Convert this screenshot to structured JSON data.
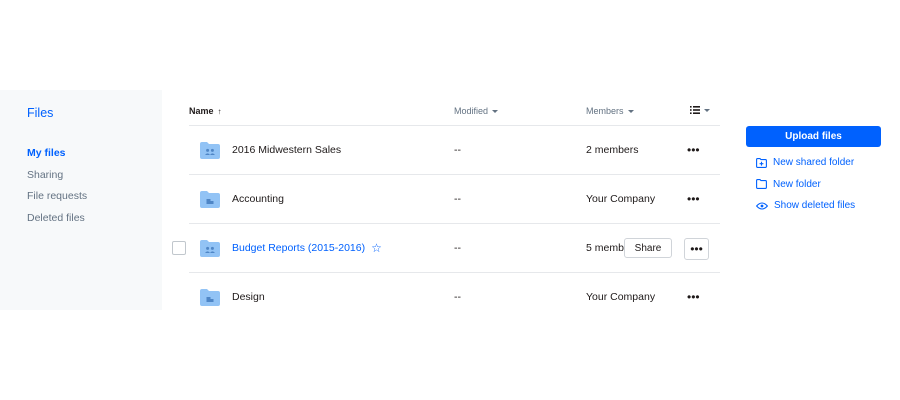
{
  "sidebar": {
    "brand": "Files",
    "items": [
      {
        "label": "My files",
        "active": true
      },
      {
        "label": "Sharing"
      },
      {
        "label": "File requests"
      },
      {
        "label": "Deleted files"
      }
    ]
  },
  "table": {
    "headers": {
      "name": "Name",
      "modified": "Modified",
      "members": "Members"
    },
    "rows": [
      {
        "name": "2016 Midwestern Sales",
        "modified": "--",
        "members": "2 members",
        "icon": "shared-folder-icon"
      },
      {
        "name": "Accounting",
        "modified": "--",
        "members": "Your Company",
        "icon": "team-folder-icon"
      },
      {
        "name": "Budget Reports (2015-2016)",
        "modified": "--",
        "members": "5 members",
        "icon": "shared-folder-icon",
        "starred": true,
        "share_label": "Share"
      },
      {
        "name": "Design",
        "modified": "--",
        "members": "Your Company",
        "icon": "team-folder-icon"
      }
    ]
  },
  "actions": {
    "upload": "Upload files",
    "new_shared_folder": "New shared folder",
    "new_folder": "New folder",
    "show_deleted": "Show deleted files"
  },
  "colors": {
    "accent": "#0061fe",
    "folder": "#92c3f5",
    "sidebar_bg": "#f7f9fa"
  }
}
